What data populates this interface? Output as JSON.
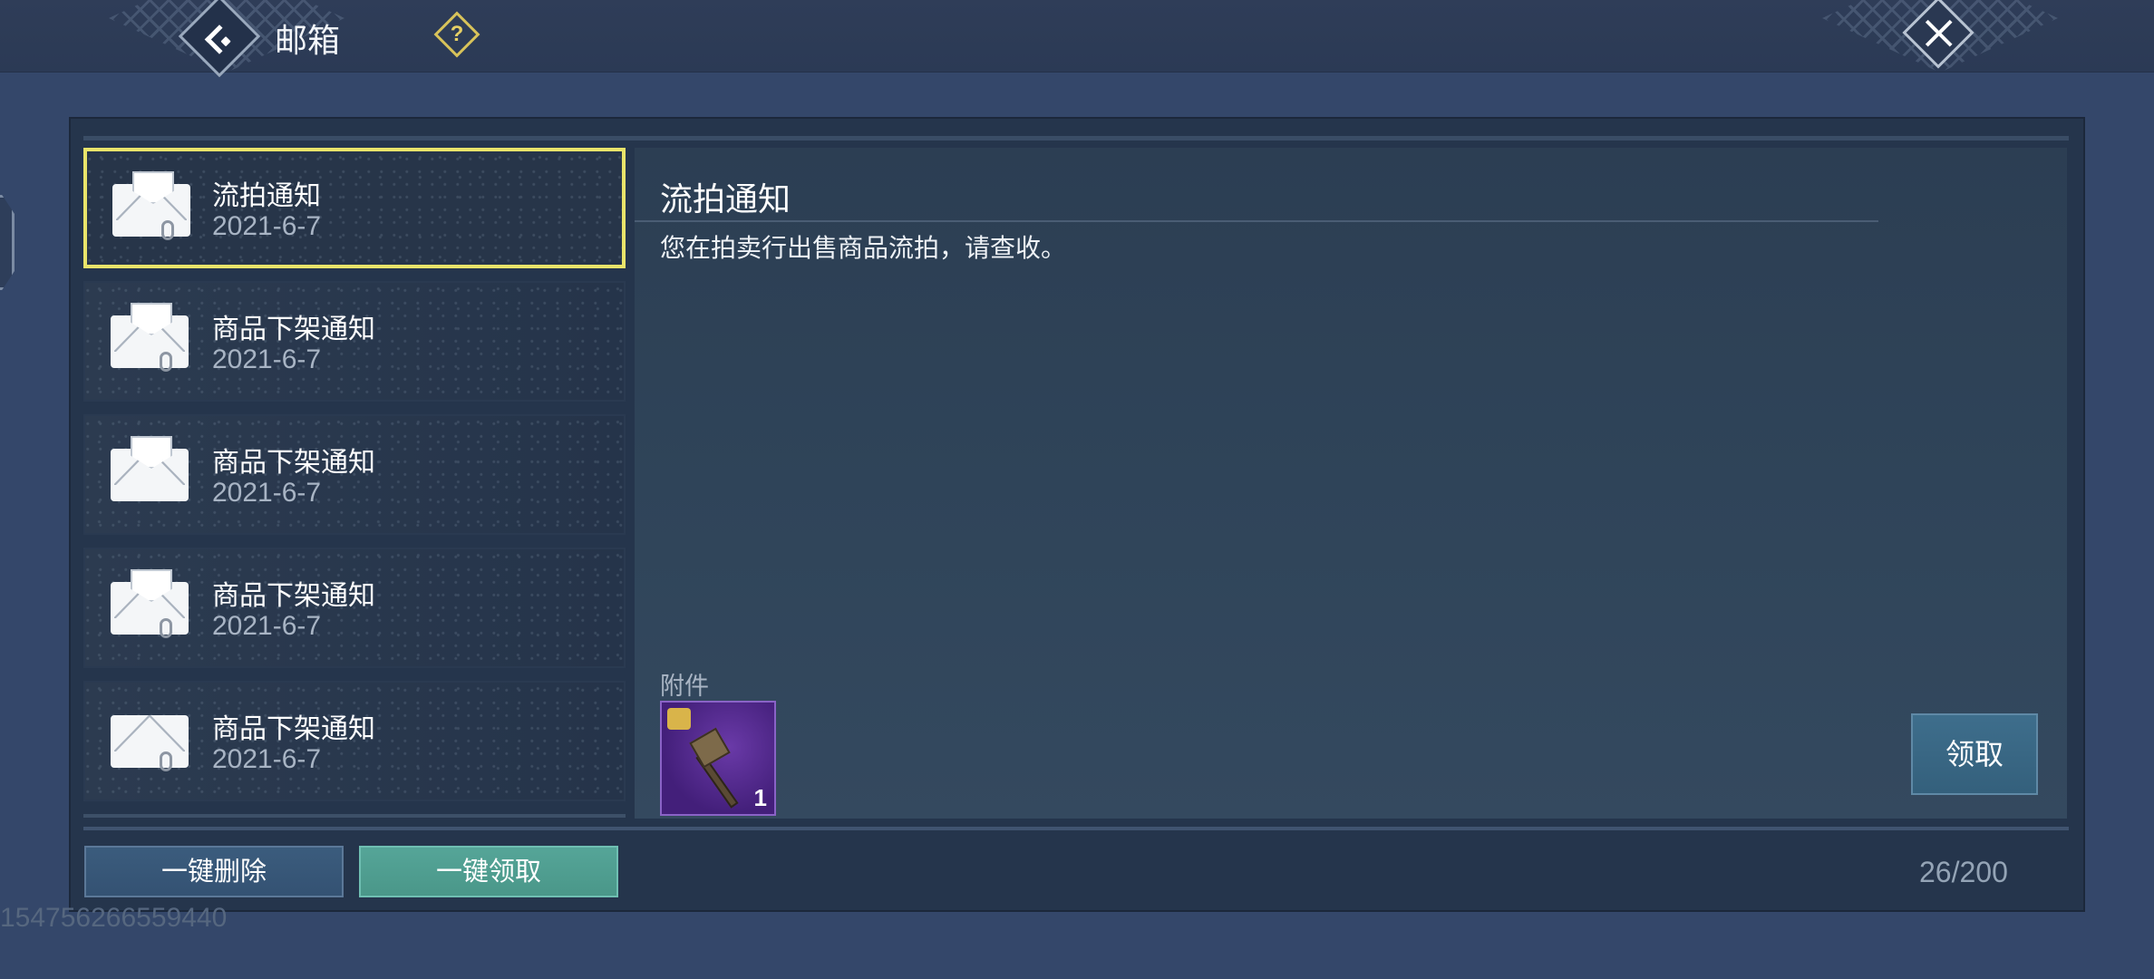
{
  "header": {
    "title": "邮箱",
    "back_icon": "back-arrow-icon",
    "help_icon": "question-icon",
    "help_glyph": "?",
    "close_icon": "close-icon"
  },
  "mail_list": [
    {
      "title": "流拍通知",
      "date": "2021-6-7",
      "selected": true,
      "icon": "opened-envelope-icon"
    },
    {
      "title": "商品下架通知",
      "date": "2021-6-7",
      "selected": false,
      "icon": "opened-envelope-icon"
    },
    {
      "title": "商品下架通知",
      "date": "2021-6-7",
      "selected": false,
      "icon": "opened-envelope-icon"
    },
    {
      "title": "商品下架通知",
      "date": "2021-6-7",
      "selected": false,
      "icon": "opened-envelope-icon"
    },
    {
      "title": "商品下架通知",
      "date": "2021-6-7",
      "selected": false,
      "icon": "closed-envelope-icon"
    }
  ],
  "detail": {
    "title": "流拍通知",
    "body": "您在拍卖行出售商品流拍，请查收。",
    "attachment_label": "附件",
    "attachment": {
      "item_icon": "hammer-icon",
      "count": "1"
    },
    "claim_label": "领取"
  },
  "footer": {
    "delete_all_label": "一键删除",
    "claim_all_label": "一键领取",
    "mail_count": "26/200"
  },
  "uid": "154756266559440",
  "colors": {
    "selected_border": "#e9e46a",
    "claim_all_button": "#55a598",
    "attachment_bg": "#6a3aa8"
  }
}
